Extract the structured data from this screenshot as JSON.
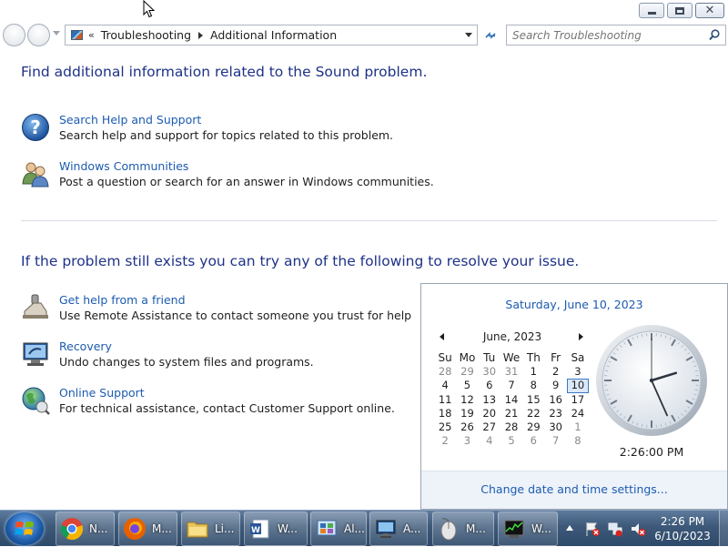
{
  "window": {
    "minimize_icon": "minimize-icon",
    "maximize_icon": "restore-icon",
    "close_icon": "close-icon"
  },
  "nav": {
    "address_prefix": "«",
    "breadcrumbs": [
      "Troubleshooting",
      "Additional Information"
    ],
    "search_placeholder": "Search Troubleshooting"
  },
  "main": {
    "heading_top": "Find additional information related to the Sound problem.",
    "heading_bottom": "If the problem still exists you can try any of the following to resolve your issue.",
    "tasks_top": [
      {
        "link": "Search Help and Support",
        "desc": "Search help and support for topics related to this problem.",
        "icon": "help-icon"
      },
      {
        "link": "Windows Communities",
        "desc": "Post a question or search for an answer in Windows communities.",
        "icon": "people-icon"
      }
    ],
    "tasks_bottom": [
      {
        "link": "Get help from a friend",
        "desc": "Use Remote Assistance to contact someone you trust for help",
        "icon": "remote-assistance-icon"
      },
      {
        "link": "Recovery",
        "desc": "Undo changes to system files and programs.",
        "icon": "recovery-icon"
      },
      {
        "link": "Online Support",
        "desc": "For technical assistance, contact Customer Support online.",
        "icon": "globe-icon"
      }
    ]
  },
  "calendar": {
    "full_date": "Saturday, June 10, 2023",
    "month_label": "June, 2023",
    "weekdays": [
      "Su",
      "Mo",
      "Tu",
      "We",
      "Th",
      "Fr",
      "Sa"
    ],
    "days": [
      [
        "28",
        "29",
        "30",
        "31",
        "1",
        "2",
        "3"
      ],
      [
        "4",
        "5",
        "6",
        "7",
        "8",
        "9",
        "10"
      ],
      [
        "11",
        "12",
        "13",
        "14",
        "15",
        "16",
        "17"
      ],
      [
        "18",
        "19",
        "20",
        "21",
        "22",
        "23",
        "24"
      ],
      [
        "25",
        "26",
        "27",
        "28",
        "29",
        "30",
        "1"
      ],
      [
        "2",
        "3",
        "4",
        "5",
        "6",
        "7",
        "8"
      ]
    ],
    "today": "10",
    "clock_time": "2:26:00 PM",
    "clock_hour": 14,
    "clock_minute": 26,
    "clock_second": 0,
    "settings_link": "Change date and time settings..."
  },
  "taskbar": {
    "items": [
      {
        "label": "N...",
        "icon": "chrome-icon"
      },
      {
        "label": "M...",
        "icon": "firefox-icon"
      },
      {
        "label": "Li...",
        "icon": "folder-icon"
      },
      {
        "label": "W...",
        "icon": "word-icon"
      },
      {
        "label": "Al...",
        "icon": "control-panel-icon"
      },
      {
        "label": "A...",
        "icon": "monitor-icon"
      },
      {
        "label": "M...",
        "icon": "mouse-icon"
      },
      {
        "label": "W...",
        "icon": "task-manager-icon"
      }
    ],
    "time": "2:26 PM",
    "date": "6/10/2023"
  },
  "colors": {
    "heading": "#1e3287",
    "link": "#1c5bb0",
    "taskbar": "#3d5878"
  }
}
